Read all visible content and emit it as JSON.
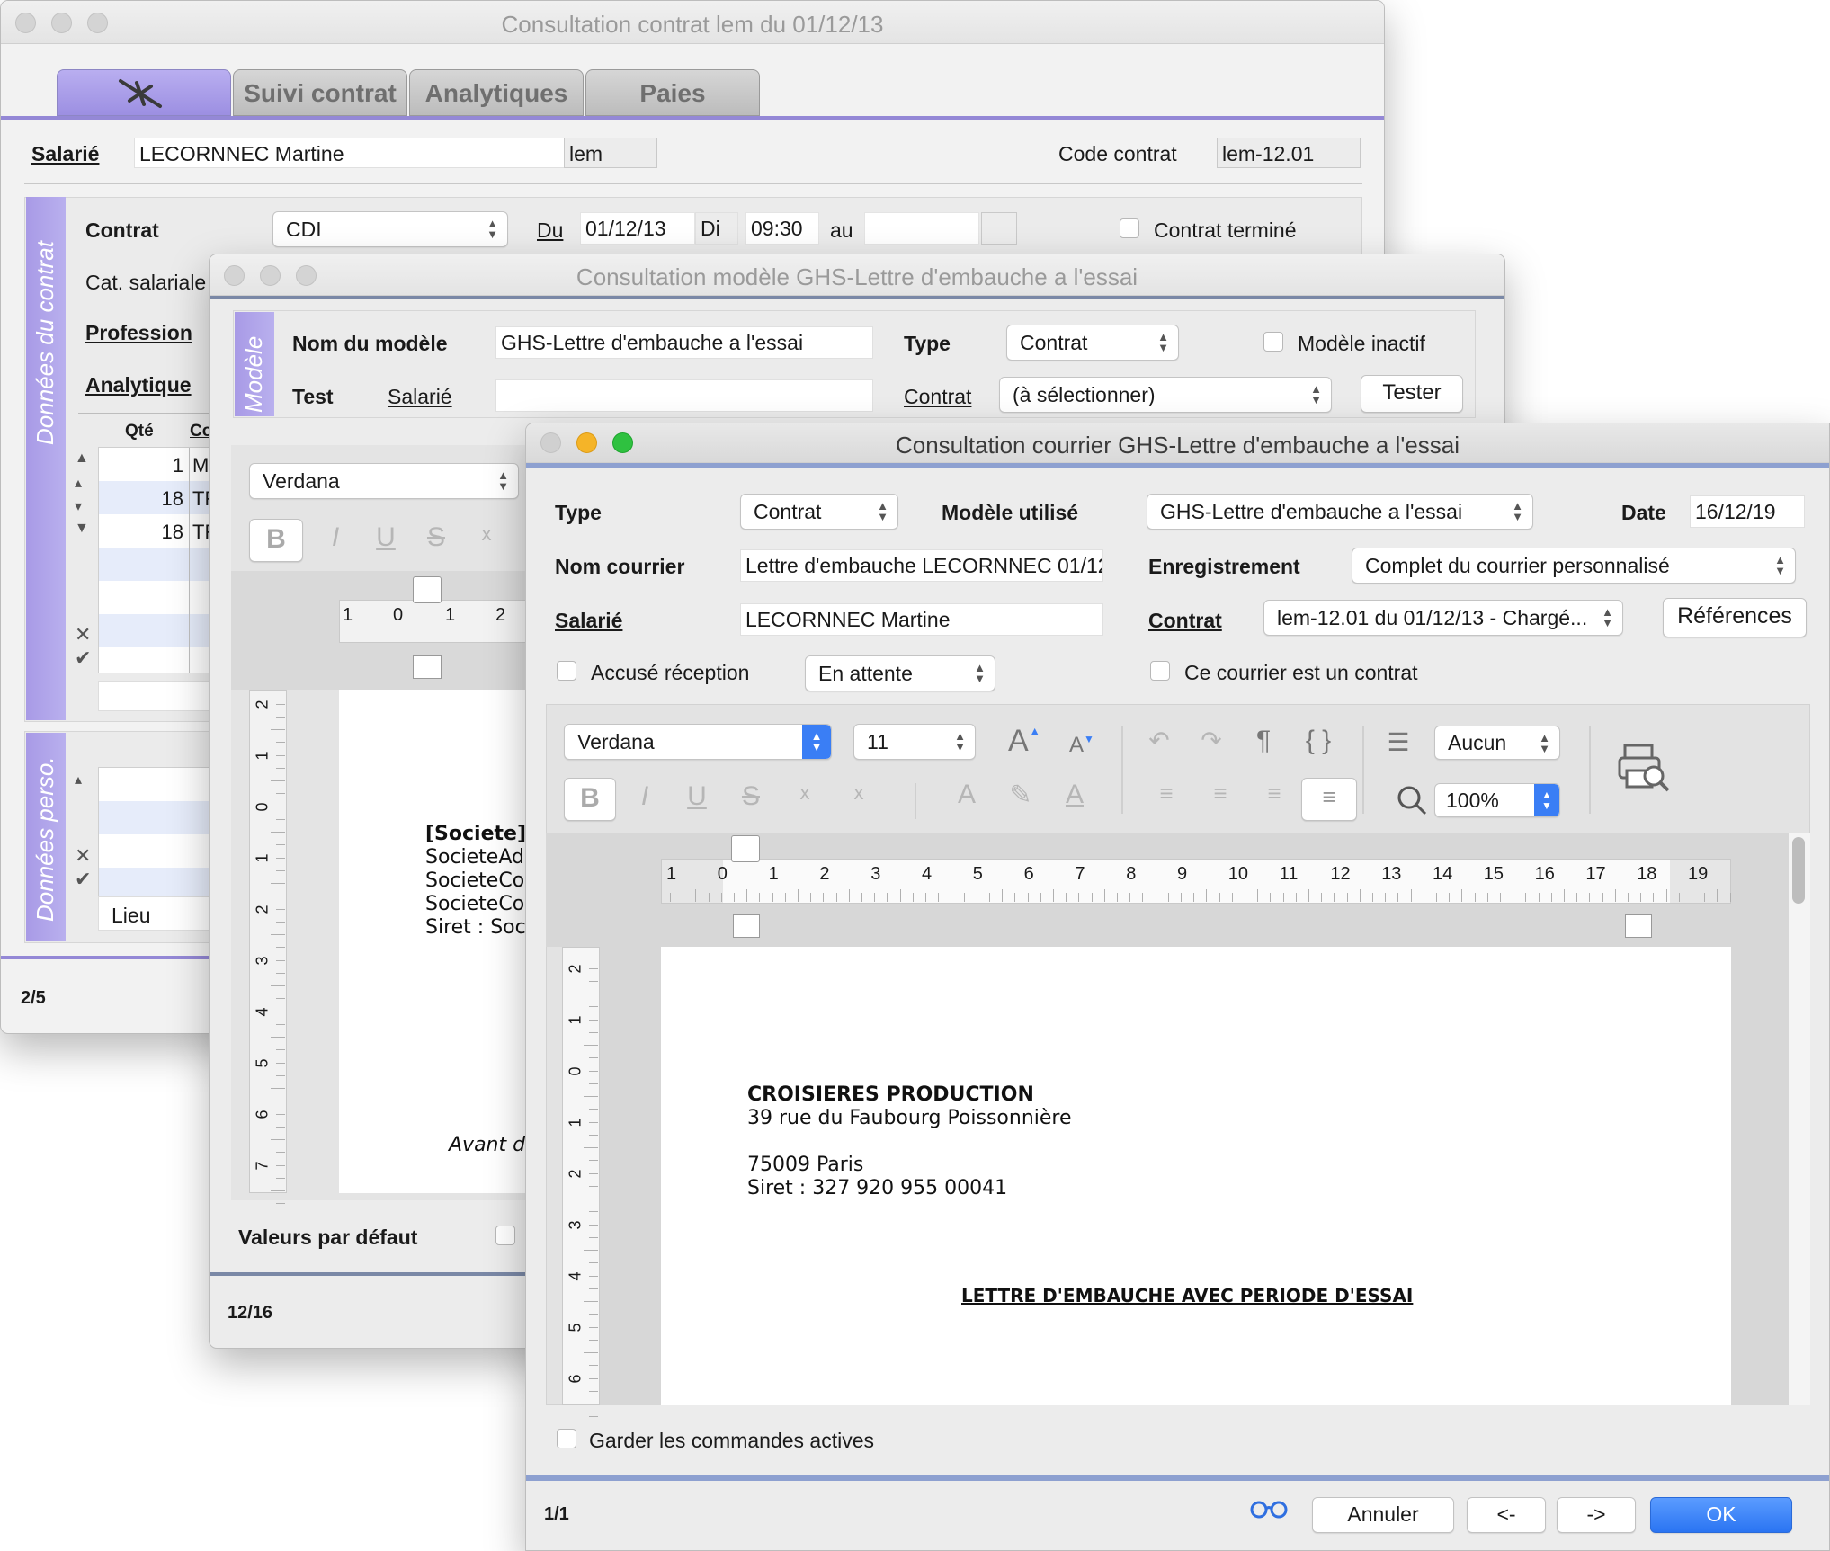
{
  "win1": {
    "title": "Consultation contrat lem du 01/12/13",
    "tabs": [
      "Suivi contrat",
      "Analytiques",
      "Paies"
    ],
    "salarie_label": "Salarié",
    "salarie_value": "LECORNNEC Martine",
    "salarie_code": "lem",
    "code_contrat_label": "Code contrat",
    "code_contrat_value": "lem-12.01",
    "side_label_1": "Données du contrat",
    "side_label_2": "Données perso.",
    "contrat_label": "Contrat",
    "contrat_value": "CDI",
    "du_label": "Du",
    "du_value": "01/12/13",
    "di_label": "Di",
    "time_value": "09:30",
    "au_label": "au",
    "contrat_termine_label": "Contrat terminé",
    "cat_label": "Cat. salariale",
    "profession_label": "Profession",
    "analytique_label": "Analytique",
    "col_qte": "Qté",
    "col_co": "Co",
    "rows": [
      {
        "qte": "1",
        "co": "M"
      },
      {
        "qte": "18",
        "co": "TF"
      },
      {
        "qte": "18",
        "co": "TF"
      }
    ],
    "lieu_label": "Lieu",
    "page_counter": "2/5"
  },
  "win2": {
    "title": "Consultation modèle GHS-Lettre d'embauche a l'essai",
    "side_label": "Modèle",
    "nom_modele_label": "Nom du modèle",
    "nom_modele_value": "GHS-Lettre d'embauche a l'essai",
    "type_label": "Type",
    "type_value": "Contrat",
    "modele_inactif_label": "Modèle inactif",
    "test_label": "Test",
    "salarie_label": "Salarié",
    "contrat_label": "Contrat",
    "contrat_value": "(à sélectionner)",
    "tester_label": "Tester",
    "font_value": "Verdana",
    "ruler_nums": [
      "1",
      "0",
      "1",
      "2"
    ],
    "vruler_nums": [
      "2",
      "1",
      "0",
      "1",
      "2",
      "3",
      "4",
      "5",
      "6",
      "7"
    ],
    "doc_lines": [
      "[Societe]",
      "SocieteAdr",
      "SocieteCo",
      "SocieteCo",
      "Siret : Soc"
    ],
    "doc_italic": "Avant d",
    "valeurs_label": "Valeurs par défaut",
    "page_counter": "12/16"
  },
  "win3": {
    "title": "Consultation courrier GHS-Lettre d'embauche a l'essai",
    "type_label": "Type",
    "type_value": "Contrat",
    "modele_label": "Modèle utilisé",
    "modele_value": "GHS-Lettre d'embauche a l'essai",
    "date_label": "Date",
    "date_value": "16/12/19",
    "nom_courrier_label": "Nom courrier",
    "nom_courrier_value": "Lettre d'embauche LECORNNEC 01/12/1",
    "enregistrement_label": "Enregistrement",
    "enregistrement_value": "Complet du courrier personnalisé",
    "salarie_label": "Salarié",
    "salarie_value": "LECORNNEC Martine",
    "contrat_label": "Contrat",
    "contrat_value": "lem-12.01 du 01/12/13 - Chargé...",
    "references_label": "Références",
    "accuse_label": "Accusé réception",
    "attente_value": "En attente",
    "est_contrat_label": "Ce courrier est un contrat",
    "font_value": "Verdana",
    "size_value": "11",
    "list_value": "Aucun",
    "zoom_value": "100%",
    "ruler_nums": [
      "1",
      "0",
      "1",
      "2",
      "3",
      "4",
      "5",
      "6",
      "7",
      "8",
      "9",
      "10",
      "11",
      "12",
      "13",
      "14",
      "15",
      "16",
      "17",
      "18",
      "19"
    ],
    "vruler_nums": [
      "2",
      "1",
      "0",
      "1",
      "2",
      "3",
      "4",
      "5",
      "6"
    ],
    "doc": {
      "company": "CROISIERES PRODUCTION",
      "address": "39 rue du Faubourg Poissonnière",
      "city": "75009 Paris",
      "siret": "Siret : 327 920 955 00041",
      "heading": "LETTRE D'EMBAUCHE AVEC PERIODE D'ESSAI"
    },
    "garder_label": "Garder les commandes actives",
    "page_counter": "1/1",
    "annuler_label": "Annuler",
    "prev_label": "<-",
    "next_label": "->",
    "ok_label": "OK"
  }
}
